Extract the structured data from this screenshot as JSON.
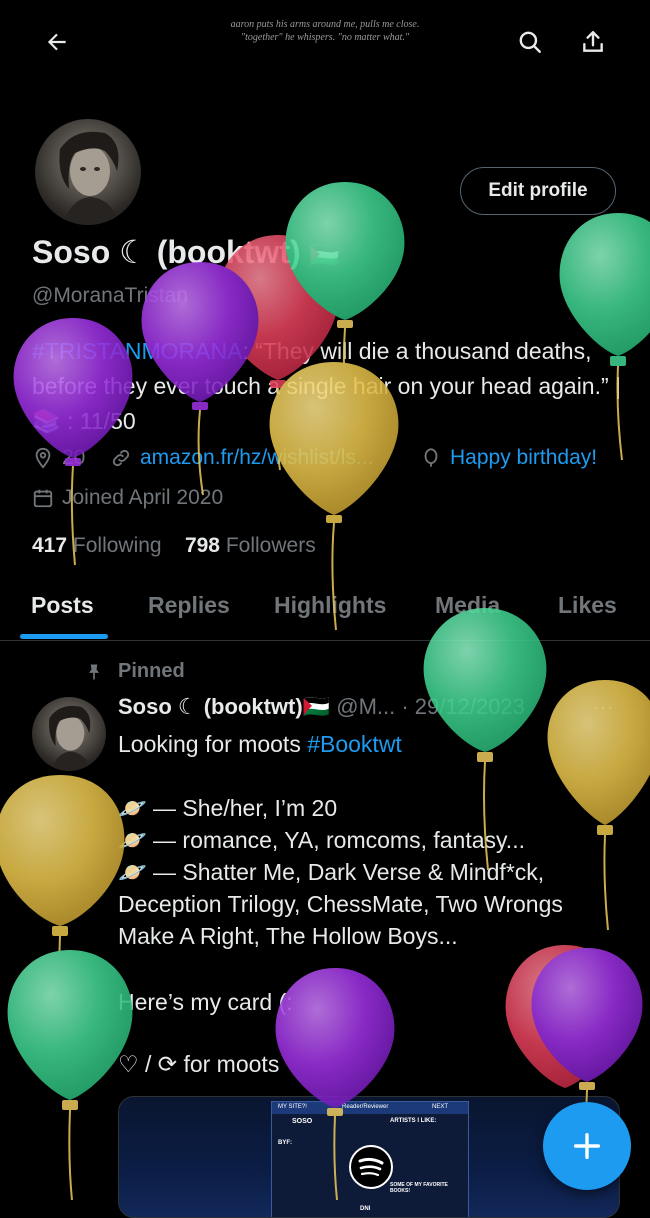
{
  "banner": {
    "quote_line1": "aaron puts his arms around me, pulls me close.",
    "quote_line2": "\"together\" he whispers. \"no matter what.\""
  },
  "header": {
    "back_icon": "arrow-left-icon",
    "search_icon": "search-icon",
    "share_icon": "share-icon"
  },
  "profile": {
    "edit_label": "Edit profile",
    "name": "Soso ☾ (booktwt)",
    "flag": "🇵🇸",
    "handle": "@MoranaTristan",
    "bio_hashtag": "#TRISTANMORANA",
    "bio_text": ": “They will die a thousand deaths, before they ever touch a single hair on your head again.” | 📚 : 11/50",
    "location": "20",
    "website": "amazon.fr/hz/wishlist/ls...",
    "birthday": "Happy birthday!",
    "joined": "Joined April 2020",
    "following_count": "417",
    "following_label": "Following",
    "followers_count": "798",
    "followers_label": "Followers"
  },
  "tabs": [
    {
      "label": "Posts",
      "active": true
    },
    {
      "label": "Replies",
      "active": false
    },
    {
      "label": "Highlights",
      "active": false
    },
    {
      "label": "Media",
      "active": false
    },
    {
      "label": "Likes",
      "active": false
    }
  ],
  "post": {
    "pinned_label": "Pinned",
    "author_name": "Soso ☾ (booktwt)",
    "flag": "🇵🇸",
    "author_handle": "@M...",
    "date": "· 29/12/2023",
    "more": "···",
    "line1_text": "Looking for moots ",
    "line1_hashtag": "#Booktwt",
    "bullet1": "🪐 — She/her, I’m 20",
    "bullet2": "🪐 — romance, YA, romcoms, fantasy...",
    "bullet3": "🪐 — Shatter Me, Dark Verse & Mindf*ck,",
    "line_cont1": "Deception Trilogy, ChessMate, Two Wrongs",
    "line_cont2": "Make A Right, The Hollow Boys...",
    "card_line": "Here’s my card (:",
    "moots_line": "♡ / ⟳ for moots"
  },
  "card": {
    "header_left": "MY SITE?!",
    "header_mid": "Reader/Reviewer",
    "header_right": "NEXT",
    "title": "SOSO",
    "bio_label": "BYF:",
    "artists_label": "ARTISTS I LIKE:",
    "books_label": "SOME OF MY FAVORITE BOOKS!",
    "dni_label": "DNI"
  },
  "fab": {
    "icon": "plus-icon"
  },
  "colors": {
    "accent": "#1d9bf0",
    "balloon_green": "#3ecf8e",
    "balloon_purple": "#9b30e0",
    "balloon_red": "#e0405a",
    "balloon_yellow": "#e3c04a"
  }
}
